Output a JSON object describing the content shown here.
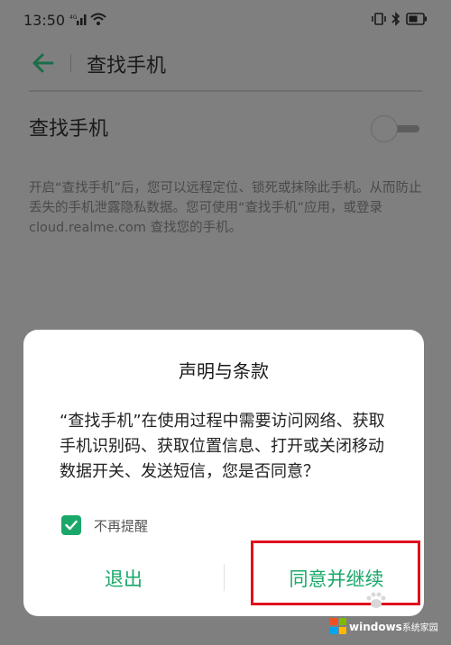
{
  "status_bar": {
    "time": "13:50",
    "network": "4G"
  },
  "header": {
    "title": "查找手机"
  },
  "setting": {
    "label": "查找手机"
  },
  "description": "开启“查找手机”后，您可以远程定位、锁死或抹除此手机。从而防止丢失的手机泄露隐私数据。您可使用“查找手机”应用，或登录 cloud.realme.com 查找您的手机。",
  "dialog": {
    "title": "声明与条款",
    "body": "“查找手机”在使用过程中需要访问网络、获取手机识别码、获取位置信息、打开或关闭移动数据开关、发送短信，您是否同意？",
    "checkbox_label": "不再提醒",
    "checkbox_checked": true,
    "exit_label": "退出",
    "agree_label": "同意并继续"
  },
  "colors": {
    "accent": "#1aa86a",
    "highlight_box": "#e0101e",
    "overlay": "#7f7f7f"
  },
  "watermark": {
    "brand": "windows",
    "suffix": "系统家园"
  }
}
